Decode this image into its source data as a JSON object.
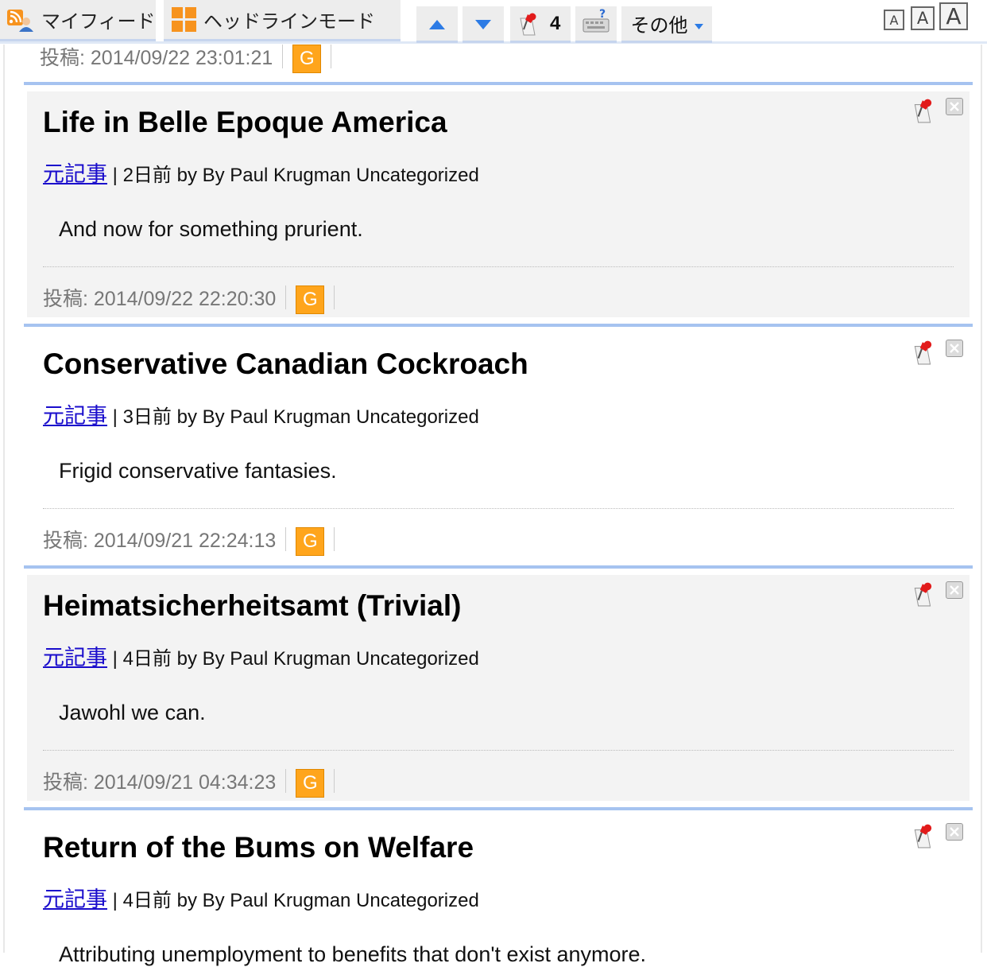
{
  "toolbar": {
    "my_feed_label": "マイフィード",
    "headline_mode_label": "ヘッドラインモード",
    "pin_count": "4",
    "other_label": "その他",
    "font_small": "A",
    "font_medium": "A",
    "font_large": "A"
  },
  "top_footer": {
    "posted": "投稿: 2014/09/22 23:01:21",
    "g_label": "G"
  },
  "entries": [
    {
      "title": "Life in Belle Epoque America",
      "source_link": "元記事",
      "age": "2日前",
      "byline": "by By Paul Krugman Uncategorized",
      "summary": "And now for something prurient.",
      "posted": "投稿: 2014/09/22 22:20:30",
      "g_label": "G"
    },
    {
      "title": "Conservative Canadian Cockroach",
      "source_link": "元記事",
      "age": "3日前",
      "byline": "by By Paul Krugman Uncategorized",
      "summary": "Frigid conservative fantasies.",
      "posted": "投稿: 2014/09/21 22:24:13",
      "g_label": "G"
    },
    {
      "title": "Heimatsicherheitsamt (Trivial)",
      "source_link": "元記事",
      "age": "4日前",
      "byline": "by By Paul Krugman Uncategorized",
      "summary": "Jawohl we can.",
      "posted": "投稿: 2014/09/21 04:34:23",
      "g_label": "G"
    },
    {
      "title": "Return of the Bums on Welfare",
      "source_link": "元記事",
      "age": "4日前",
      "byline": "by By Paul Krugman Uncategorized",
      "summary": "Attributing unemployment to benefits that don't exist anymore."
    }
  ],
  "colors": {
    "accent_border": "#a6c3f0",
    "link": "#1a0dcc",
    "g_button": "#ffa51c"
  }
}
